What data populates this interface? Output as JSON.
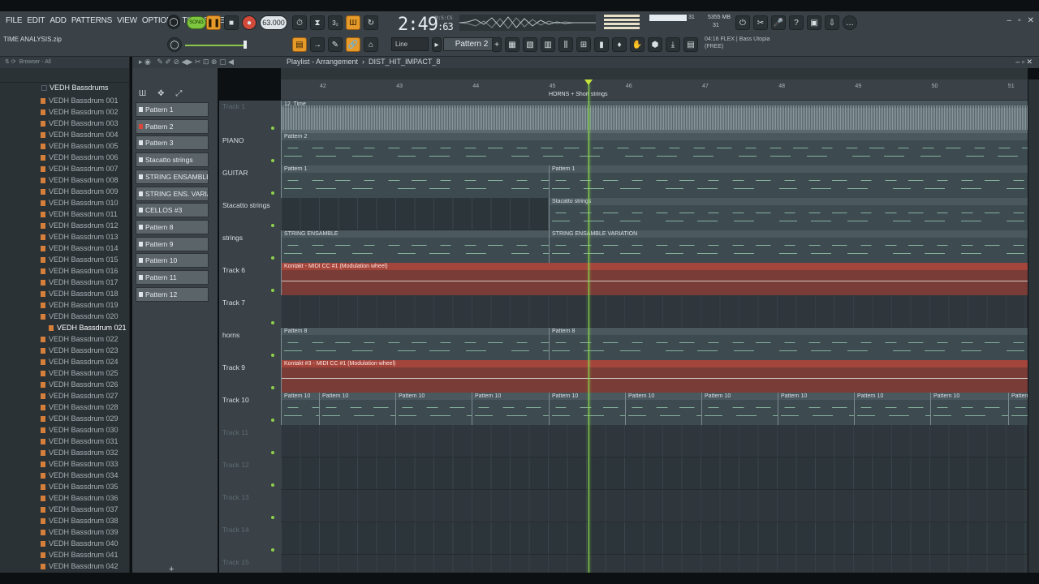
{
  "menu": [
    "FILE",
    "EDIT",
    "ADD",
    "PATTERNS",
    "VIEW",
    "OPTIONS",
    "TOOLS",
    "HELP"
  ],
  "hint_text": "TIME ANALYSIS.zip",
  "transport": {
    "song_label": "SONG",
    "tempo": "63.000",
    "time": "2:49",
    "time_sub": "63",
    "time_unit": "M:S:CS"
  },
  "memory": {
    "cpu": "31",
    "ram": "5355 MB",
    "poly": "31"
  },
  "snap": "Line",
  "pattern_selector": "Pattern 2",
  "plugin_info": {
    "line1": "04:16  FLEX | Bass Utopia",
    "line2": "(FREE)"
  },
  "browser": {
    "header": "Browser - All",
    "folder": "VEDH Bassdrums",
    "items": [
      "VEDH Bassdrum 001",
      "VEDH Bassdrum 002",
      "VEDH Bassdrum 003",
      "VEDH Bassdrum 004",
      "VEDH Bassdrum 005",
      "VEDH Bassdrum 006",
      "VEDH Bassdrum 007",
      "VEDH Bassdrum 008",
      "VEDH Bassdrum 009",
      "VEDH Bassdrum 010",
      "VEDH Bassdrum 011",
      "VEDH Bassdrum 012",
      "VEDH Bassdrum 013",
      "VEDH Bassdrum 014",
      "VEDH Bassdrum 015",
      "VEDH Bassdrum 016",
      "VEDH Bassdrum 017",
      "VEDH Bassdrum 018",
      "VEDH Bassdrum 019",
      "VEDH Bassdrum 020",
      "VEDH Bassdrum 021",
      "VEDH Bassdrum 022",
      "VEDH Bassdrum 023",
      "VEDH Bassdrum 024",
      "VEDH Bassdrum 025",
      "VEDH Bassdrum 026",
      "VEDH Bassdrum 027",
      "VEDH Bassdrum 028",
      "VEDH Bassdrum 029",
      "VEDH Bassdrum 030",
      "VEDH Bassdrum 031",
      "VEDH Bassdrum 032",
      "VEDH Bassdrum 033",
      "VEDH Bassdrum 034",
      "VEDH Bassdrum 035",
      "VEDH Bassdrum 036",
      "VEDH Bassdrum 037",
      "VEDH Bassdrum 038",
      "VEDH Bassdrum 039",
      "VEDH Bassdrum 040",
      "VEDH Bassdrum 041",
      "VEDH Bassdrum 042"
    ],
    "selected_index": 20
  },
  "picker": [
    "Pattern 1",
    "Pattern 2",
    "Pattern 3",
    "Stacatto strings",
    "STRING ENSAMBLE",
    "STRING ENS. VARIATION",
    "CELLOS #3",
    "Pattern 8",
    "Pattern 9",
    "Pattern 10",
    "Pattern 11",
    "Pattern 12"
  ],
  "picker_selected": 1,
  "playlist": {
    "title": "Playlist - Arrangement",
    "arrangement": "DIST_HIT_IMPACT_8",
    "marker": "HORNS + Short strings",
    "bars": [
      "42",
      "43",
      "44",
      "45",
      "46",
      "47",
      "48",
      "49",
      "50",
      "51"
    ],
    "tracks": [
      {
        "name": "Track 1",
        "dim": true
      },
      {
        "name": "PIANO"
      },
      {
        "name": "GUITAR"
      },
      {
        "name": "Stacatto strings"
      },
      {
        "name": "strings"
      },
      {
        "name": "Track 6"
      },
      {
        "name": "Track 7"
      },
      {
        "name": "horns"
      },
      {
        "name": "Track 9"
      },
      {
        "name": "Track 10"
      },
      {
        "name": "Track 11",
        "dim": true
      },
      {
        "name": "Track 12",
        "dim": true
      },
      {
        "name": "Track 13",
        "dim": true
      },
      {
        "name": "Track 14",
        "dim": true
      },
      {
        "name": "Track 15",
        "dim": true
      }
    ],
    "clips": {
      "audio": "12. Time",
      "piano": "Pattern 2",
      "guitar": "Pattern 1",
      "stacatto": "Stacatto strings",
      "strings_a": "STRING ENSAMBLE",
      "strings_b": "STRING ENSAMBLE VARIATION",
      "auto6": "Kontakt - MIDI CC #1 (Modulation wheel)",
      "horns": "Pattern 8",
      "auto9": "Kontakt #3 - MIDI CC #1 (Modulation wheel)",
      "track10": "Pattern 10"
    }
  },
  "colors": {
    "accent": "#e69a2a",
    "playhead": "#8be04a",
    "automation": "#a4453c"
  }
}
